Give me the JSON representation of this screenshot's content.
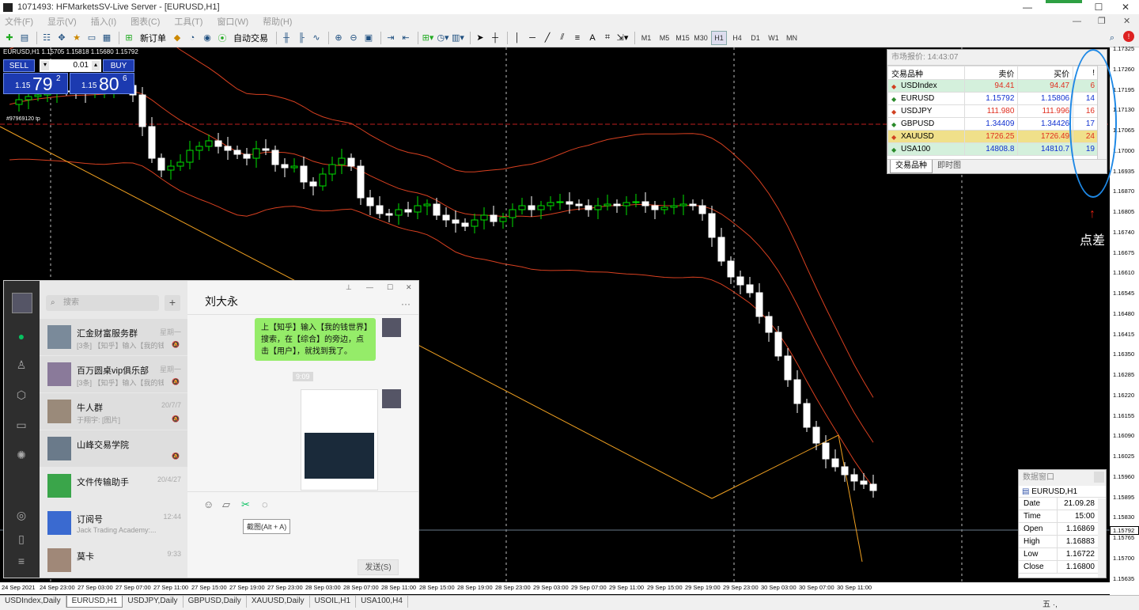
{
  "window": {
    "title": "1071493: HFMarketsSV-Live Server - [EURUSD,H1]",
    "minimize": "—",
    "maximize": "☐",
    "close": "✕"
  },
  "menu": [
    "文件(F)",
    "显示(V)",
    "插入(I)",
    "图表(C)",
    "工具(T)",
    "窗口(W)",
    "帮助(H)"
  ],
  "menu_right": {
    "minimize": "—",
    "restore": "❐",
    "close": "✕"
  },
  "toolbar": {
    "new_order": "新订单",
    "auto_trade": "自动交易",
    "timeframes": [
      "M1",
      "M5",
      "M15",
      "M30",
      "H1",
      "H4",
      "D1",
      "W1",
      "MN"
    ],
    "active_tf": "H1"
  },
  "chart": {
    "symbol_label": "EURUSD,H1  1.15705 1.15818 1.15680 1.15792",
    "tp_label": "#97969120 tp",
    "one_click": {
      "sell_label": "SELL",
      "buy_label": "BUY",
      "lot": "0.01",
      "bid_prefix": "1.15",
      "bid_big": "79",
      "bid_sup": "2",
      "ask_prefix": "1.15",
      "ask_big": "80",
      "ask_sup": "6"
    },
    "price_ticks": [
      "1.17325",
      "1.17260",
      "1.17195",
      "1.17130",
      "1.17065",
      "1.17000",
      "1.16935",
      "1.16870",
      "1.16805",
      "1.16740",
      "1.16675",
      "1.16610",
      "1.16545",
      "1.16480",
      "1.16415",
      "1.16350",
      "1.16285",
      "1.16220",
      "1.16155",
      "1.16090",
      "1.16025",
      "1.15960",
      "1.15895",
      "1.15830",
      "1.15765",
      "1.15700",
      "1.15635"
    ],
    "current_price": "1.15792",
    "time_ticks": [
      "24 Sep 2021",
      "24 Sep 23:00",
      "27 Sep 03:00",
      "27 Sep 07:00",
      "27 Sep 11:00",
      "27 Sep 15:00",
      "27 Sep 19:00",
      "27 Sep 23:00",
      "28 Sep 03:00",
      "28 Sep 07:00",
      "28 Sep 11:00",
      "28 Sep 15:00",
      "28 Sep 19:00",
      "28 Sep 23:00",
      "29 Sep 03:00",
      "29 Sep 07:00",
      "29 Sep 11:00",
      "29 Sep 15:00",
      "29 Sep 19:00",
      "29 Sep 23:00",
      "30 Sep 03:00",
      "30 Sep 07:00",
      "30 Sep 11:00"
    ]
  },
  "market_watch": {
    "title": "市场报价: 14:43:07",
    "headers": [
      "交易品种",
      "卖价",
      "买价",
      "!"
    ],
    "rows": [
      {
        "symbol": "USDIndex",
        "bid": "94.41",
        "ask": "94.47",
        "spread": "6",
        "dir": "down",
        "bg": "#d4f0dc",
        "color": "#e03020"
      },
      {
        "symbol": "EURUSD",
        "bid": "1.15792",
        "ask": "1.15806",
        "spread": "14",
        "dir": "up",
        "bg": "#ffffff",
        "color": "#1030d0"
      },
      {
        "symbol": "USDJPY",
        "bid": "111.980",
        "ask": "111.996",
        "spread": "16",
        "dir": "down",
        "bg": "#ffffff",
        "color": "#e03020"
      },
      {
        "symbol": "GBPUSD",
        "bid": "1.34409",
        "ask": "1.34426",
        "spread": "17",
        "dir": "up",
        "bg": "#ffffff",
        "color": "#1030d0"
      },
      {
        "symbol": "XAUUSD",
        "bid": "1726.25",
        "ask": "1726.49",
        "spread": "24",
        "dir": "down",
        "bg": "#f0e08a",
        "color": "#e03020"
      },
      {
        "symbol": "USA100",
        "bid": "14808.8",
        "ask": "14810.7",
        "spread": "19",
        "dir": "up",
        "bg": "#d4f0dc",
        "color": "#1030d0"
      }
    ],
    "tabs": [
      "交易品种",
      "即时图"
    ]
  },
  "annotation": {
    "arrow": "↑",
    "text": "点差"
  },
  "data_window": {
    "title": "数据窗口",
    "symbol": "EURUSD,H1",
    "rows": [
      {
        "k": "Date",
        "v": "21.09.28"
      },
      {
        "k": "Time",
        "v": "15:00"
      },
      {
        "k": "Open",
        "v": "1.16869"
      },
      {
        "k": "High",
        "v": "1.16883"
      },
      {
        "k": "Low",
        "v": "1.16722"
      },
      {
        "k": "Close",
        "v": "1.16800"
      }
    ]
  },
  "wechat": {
    "search_placeholder": "搜索",
    "conversations": [
      {
        "name": "汇金财富服务群",
        "preview": "[3条] 【知乎】输入【我的钱...",
        "time": "星期一",
        "mute": "🔕"
      },
      {
        "name": "百万圆桌vip俱乐部",
        "preview": "[3条] 【知乎】输入【我的钱...",
        "time": "星期一",
        "mute": "🔕"
      },
      {
        "name": "牛人群",
        "preview": "于翔宇: [图片]",
        "time": "20/7/7",
        "mute": "🔕"
      },
      {
        "name": "山峰交易学院",
        "preview": "",
        "time": "",
        "mute": "🔕"
      },
      {
        "name": "文件传输助手",
        "preview": "",
        "time": "20/4/27",
        "mute": ""
      },
      {
        "name": "订阅号",
        "preview": "Jack Trading Academy:...",
        "time": "12:44",
        "mute": ""
      },
      {
        "name": "莫卡",
        "preview": "",
        "time": "9:33",
        "mute": ""
      }
    ],
    "chat_title": "刘大永",
    "message_text": "上【知乎】输入【我的钱世界】搜索，在【综合】的旁边，点击【用户】，就找到我了。",
    "timestamp": "9:09",
    "tooltip": "截图(Alt + A)",
    "send_label": "发送(S)",
    "more": "···"
  },
  "chart_tabs": [
    "USDIndex,Daily",
    "EURUSD,H1",
    "USDJPY,Daily",
    "GBPUSD,Daily",
    "XAUUSD,Daily",
    "USOIL,H1",
    "USA100,H4"
  ],
  "active_chart_tab": "EURUSD,H1",
  "tray_text": "五 ·,"
}
